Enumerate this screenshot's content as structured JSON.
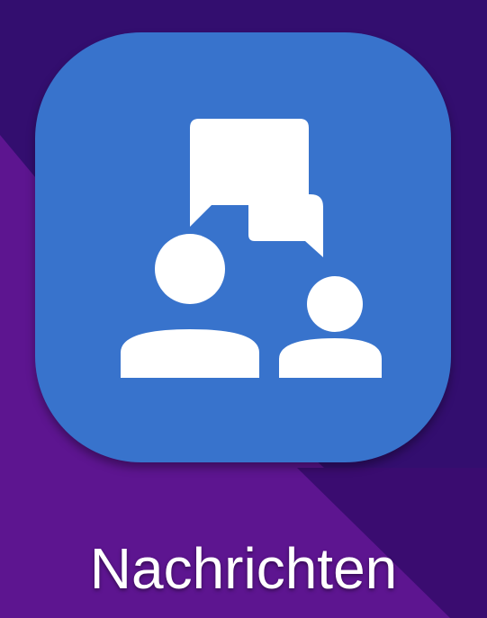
{
  "home_screen": {
    "wallpaper_colors": {
      "top": "#330e6f",
      "lower_left": "#5d1590",
      "lower_right_band": "#3a0c70"
    },
    "app": {
      "label": "Nachrichten",
      "icon": "chat-people-icon",
      "icon_background": "#3873cc",
      "icon_foreground": "#ffffff"
    }
  }
}
